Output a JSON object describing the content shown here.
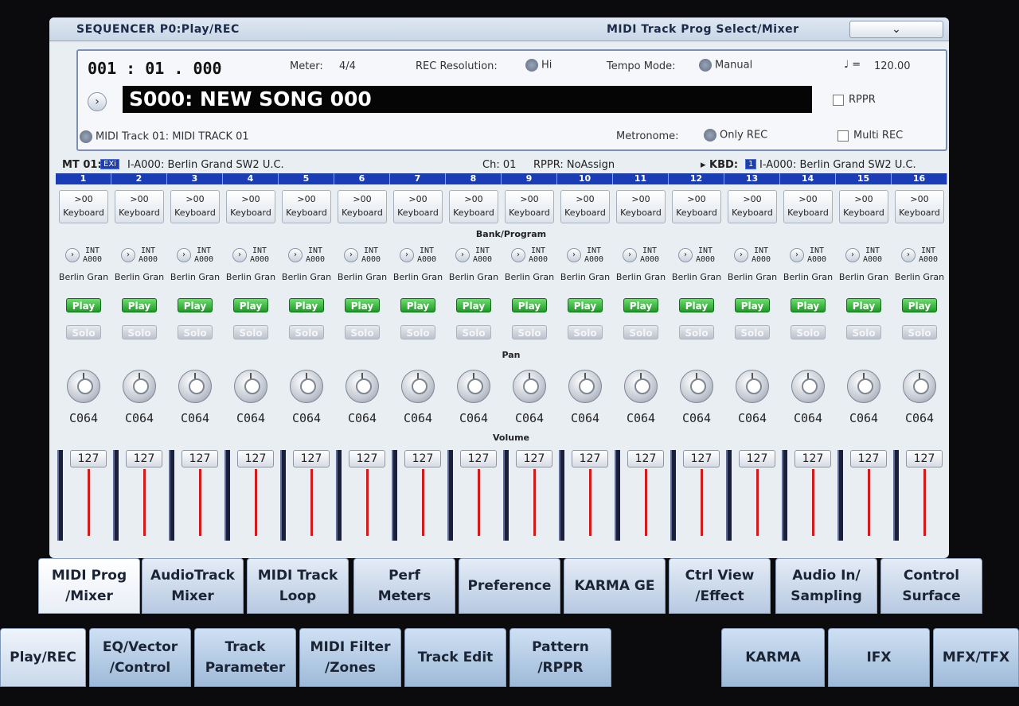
{
  "header": {
    "title": "SEQUENCER P0:Play/REC",
    "page": "MIDI Track Prog Select/Mixer",
    "menu": "⌄"
  },
  "song": {
    "position": "001 : 01 . 000",
    "meter_label": "Meter:",
    "meter": "4/4",
    "rec_res_label": "REC Resolution:",
    "rec_res": "Hi",
    "tempo_mode_label": "Tempo Mode:",
    "tempo_mode": "Manual",
    "tempo_icon": "♩ =",
    "tempo": "120.00",
    "name": "S000: NEW SONG 000",
    "rppr_label": "RPPR",
    "track": "MIDI Track 01: MIDI TRACK 01",
    "metronome_label": "Metronome:",
    "metronome": "Only REC",
    "multi_rec_label": "Multi REC",
    "arrow": "›"
  },
  "mt": {
    "label": "MT 01:",
    "badge": "EXi",
    "program": "I-A000: Berlin Grand SW2 U.C.",
    "ch": "Ch: 01",
    "rppr": "RPPR: NoAssign",
    "kbd": "▸ KBD:",
    "kbd_num": "1",
    "kbd_prog": "I-A000: Berlin Grand SW2 U.C."
  },
  "labels": {
    "bank": "Bank/Program",
    "pan": "Pan",
    "volume": "Volume"
  },
  "tracks": [
    {
      "num": "1",
      "kb": ">00",
      "kb2": "Keyboard",
      "bank": "INT",
      "prog": "A000",
      "name": "Berlin Gran",
      "play": "Play",
      "solo": "Solo",
      "pan": "C064",
      "vol": "127"
    },
    {
      "num": "2",
      "kb": ">00",
      "kb2": "Keyboard",
      "bank": "INT",
      "prog": "A000",
      "name": "Berlin Gran",
      "play": "Play",
      "solo": "Solo",
      "pan": "C064",
      "vol": "127"
    },
    {
      "num": "3",
      "kb": ">00",
      "kb2": "Keyboard",
      "bank": "INT",
      "prog": "A000",
      "name": "Berlin Gran",
      "play": "Play",
      "solo": "Solo",
      "pan": "C064",
      "vol": "127"
    },
    {
      "num": "4",
      "kb": ">00",
      "kb2": "Keyboard",
      "bank": "INT",
      "prog": "A000",
      "name": "Berlin Gran",
      "play": "Play",
      "solo": "Solo",
      "pan": "C064",
      "vol": "127"
    },
    {
      "num": "5",
      "kb": ">00",
      "kb2": "Keyboard",
      "bank": "INT",
      "prog": "A000",
      "name": "Berlin Gran",
      "play": "Play",
      "solo": "Solo",
      "pan": "C064",
      "vol": "127"
    },
    {
      "num": "6",
      "kb": ">00",
      "kb2": "Keyboard",
      "bank": "INT",
      "prog": "A000",
      "name": "Berlin Gran",
      "play": "Play",
      "solo": "Solo",
      "pan": "C064",
      "vol": "127"
    },
    {
      "num": "7",
      "kb": ">00",
      "kb2": "Keyboard",
      "bank": "INT",
      "prog": "A000",
      "name": "Berlin Gran",
      "play": "Play",
      "solo": "Solo",
      "pan": "C064",
      "vol": "127"
    },
    {
      "num": "8",
      "kb": ">00",
      "kb2": "Keyboard",
      "bank": "INT",
      "prog": "A000",
      "name": "Berlin Gran",
      "play": "Play",
      "solo": "Solo",
      "pan": "C064",
      "vol": "127"
    },
    {
      "num": "9",
      "kb": ">00",
      "kb2": "Keyboard",
      "bank": "INT",
      "prog": "A000",
      "name": "Berlin Gran",
      "play": "Play",
      "solo": "Solo",
      "pan": "C064",
      "vol": "127"
    },
    {
      "num": "10",
      "kb": ">00",
      "kb2": "Keyboard",
      "bank": "INT",
      "prog": "A000",
      "name": "Berlin Gran",
      "play": "Play",
      "solo": "Solo",
      "pan": "C064",
      "vol": "127"
    },
    {
      "num": "11",
      "kb": ">00",
      "kb2": "Keyboard",
      "bank": "INT",
      "prog": "A000",
      "name": "Berlin Gran",
      "play": "Play",
      "solo": "Solo",
      "pan": "C064",
      "vol": "127"
    },
    {
      "num": "12",
      "kb": ">00",
      "kb2": "Keyboard",
      "bank": "INT",
      "prog": "A000",
      "name": "Berlin Gran",
      "play": "Play",
      "solo": "Solo",
      "pan": "C064",
      "vol": "127"
    },
    {
      "num": "13",
      "kb": ">00",
      "kb2": "Keyboard",
      "bank": "INT",
      "prog": "A000",
      "name": "Berlin Gran",
      "play": "Play",
      "solo": "Solo",
      "pan": "C064",
      "vol": "127"
    },
    {
      "num": "14",
      "kb": ">00",
      "kb2": "Keyboard",
      "bank": "INT",
      "prog": "A000",
      "name": "Berlin Gran",
      "play": "Play",
      "solo": "Solo",
      "pan": "C064",
      "vol": "127"
    },
    {
      "num": "15",
      "kb": ">00",
      "kb2": "Keyboard",
      "bank": "INT",
      "prog": "A000",
      "name": "Berlin Gran",
      "play": "Play",
      "solo": "Solo",
      "pan": "C064",
      "vol": "127"
    },
    {
      "num": "16",
      "kb": ">00",
      "kb2": "Keyboard",
      "bank": "INT",
      "prog": "A000",
      "name": "Berlin Gran",
      "play": "Play",
      "solo": "Solo",
      "pan": "C064",
      "vol": "127"
    }
  ],
  "tabs": [
    {
      "label": "MIDI Prog\n/Mixer",
      "active": true
    },
    {
      "label": "AudioTrack\nMixer"
    },
    {
      "label": "MIDI Track\nLoop"
    },
    {
      "label": "Perf\nMeters"
    },
    {
      "label": "Preference"
    },
    {
      "label": "KARMA GE"
    },
    {
      "label": "Ctrl View\n/Effect"
    },
    {
      "label": "Audio In/\nSampling"
    },
    {
      "label": "Control\nSurface"
    }
  ],
  "bottom_tabs": [
    {
      "label": "Play/REC",
      "active": true
    },
    {
      "label": "EQ/Vector\n/Control"
    },
    {
      "label": "Track\nParameter"
    },
    {
      "label": "MIDI Filter\n/Zones"
    },
    {
      "label": "Track Edit"
    },
    {
      "label": "Pattern\n/RPPR"
    },
    {
      "label": "KARMA"
    },
    {
      "label": "IFX"
    },
    {
      "label": "MFX/TFX"
    }
  ]
}
